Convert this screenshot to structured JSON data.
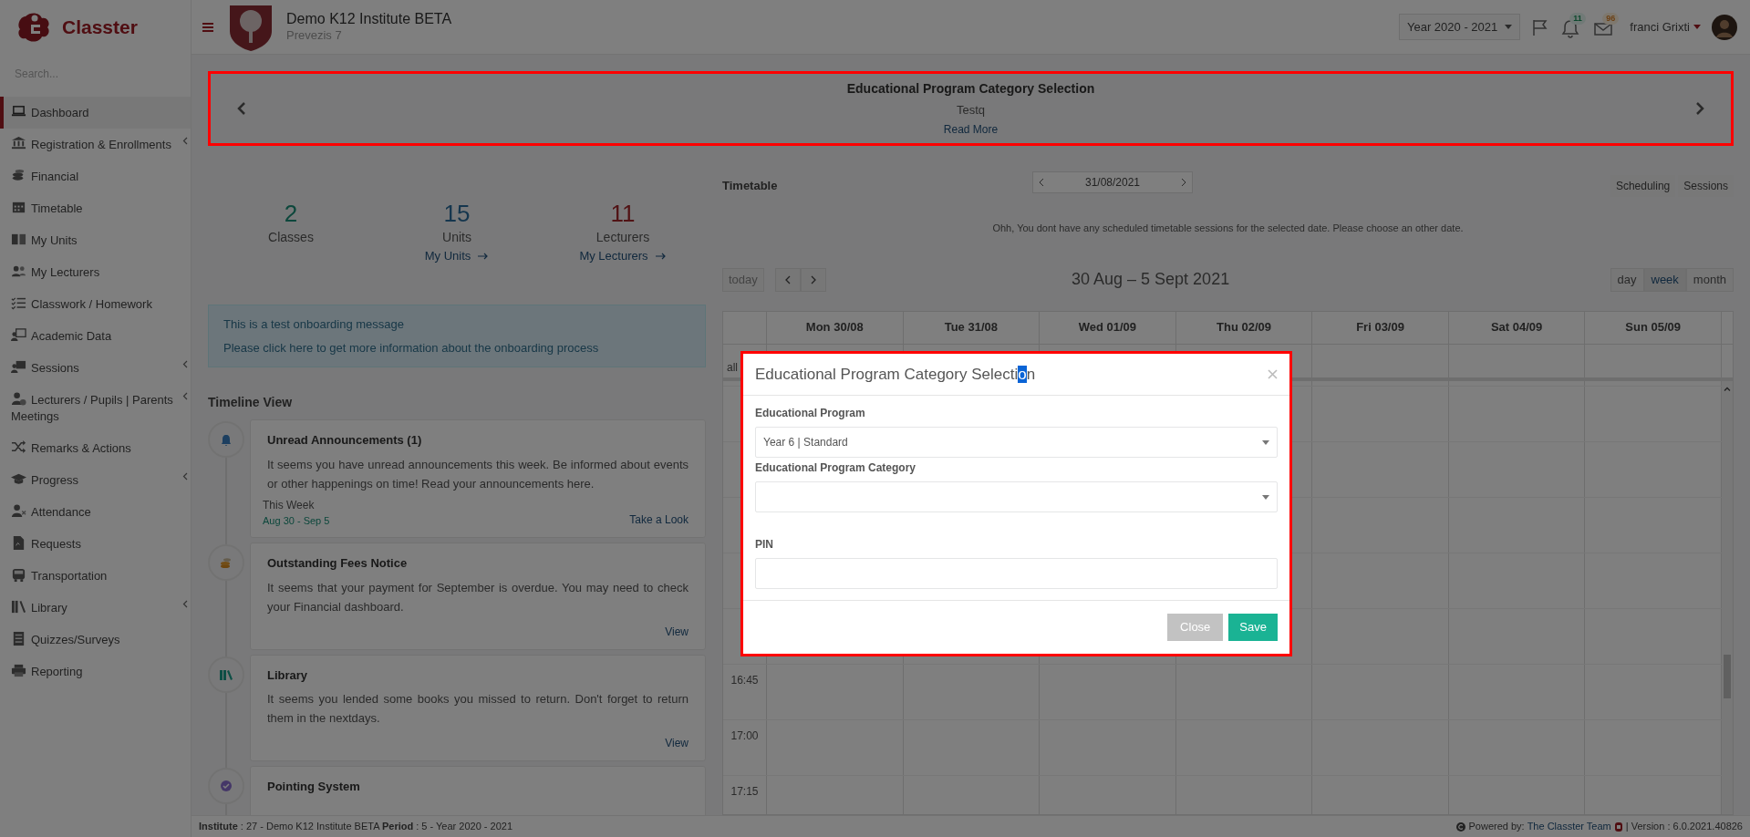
{
  "brand": {
    "name": "Classter"
  },
  "sidebar": {
    "search_placeholder": "Search...",
    "items": [
      {
        "label": "Dashboard",
        "selected": true,
        "expandable": false
      },
      {
        "label": "Registration & Enrollments",
        "selected": false,
        "expandable": true
      },
      {
        "label": "Financial",
        "selected": false,
        "expandable": false
      },
      {
        "label": "Timetable",
        "selected": false,
        "expandable": false
      },
      {
        "label": "My Units",
        "selected": false,
        "expandable": false
      },
      {
        "label": "My Lecturers",
        "selected": false,
        "expandable": false
      },
      {
        "label": "Classwork / Homework",
        "selected": false,
        "expandable": false
      },
      {
        "label": "Academic Data",
        "selected": false,
        "expandable": false
      },
      {
        "label": "Sessions",
        "selected": false,
        "expandable": true
      },
      {
        "label": "Lecturers / Pupils | Parents Meetings",
        "selected": false,
        "expandable": true
      },
      {
        "label": "Remarks & Actions",
        "selected": false,
        "expandable": false
      },
      {
        "label": "Progress",
        "selected": false,
        "expandable": true
      },
      {
        "label": "Attendance",
        "selected": false,
        "expandable": false
      },
      {
        "label": "Requests",
        "selected": false,
        "expandable": false
      },
      {
        "label": "Transportation",
        "selected": false,
        "expandable": false
      },
      {
        "label": "Library",
        "selected": false,
        "expandable": true
      },
      {
        "label": "Quizzes/Surveys",
        "selected": false,
        "expandable": false
      },
      {
        "label": "Reporting",
        "selected": false,
        "expandable": false
      }
    ]
  },
  "header": {
    "institute": "Demo K12 Institute BETA",
    "address": "Prevezis 7",
    "year": "Year 2020 - 2021",
    "notifications": "11",
    "messages": "96",
    "user": "franci Grixti"
  },
  "banner": {
    "title": "Educational Program Category Selection",
    "text": "Testq",
    "link": "Read More"
  },
  "stats": [
    {
      "value": "2",
      "label": "Classes"
    },
    {
      "value": "15",
      "label": "Units",
      "link": "My Units"
    },
    {
      "value": "11",
      "label": "Lecturers",
      "link": "My Lecturers"
    }
  ],
  "onboarding": {
    "message": "This is a test onboarding message",
    "link": "Please click here to get more information about the onboarding process"
  },
  "timeline": {
    "title": "Timeline View",
    "items": [
      {
        "title": "Unread Announcements (1)",
        "text": "It seems you have unread announcements this week. Be informed about events or other happenings on time! Read your announcements here.",
        "period_label": "This Week",
        "period": "Aug 30 - Sep 5",
        "link": "Take a Look"
      },
      {
        "title": "Outstanding Fees Notice",
        "text": "It seems that your payment for September is overdue. You may need to check your Financial dashboard.",
        "link": "View"
      },
      {
        "title": "Library",
        "text": "It seems you lended some books you missed to return. Don't forget to return them in the nextdays.",
        "link": "View"
      },
      {
        "title": "Pointing System"
      }
    ]
  },
  "timetable": {
    "title": "Timetable",
    "date": "31/08/2021",
    "buttons": [
      "Scheduling",
      "Sessions"
    ],
    "message": "Ohh, You dont have any scheduled timetable sessions for the selected date. Please choose an other date.",
    "today": "today",
    "range": "30 Aug – 5 Sept 2021",
    "views": [
      {
        "label": "day",
        "selected": false
      },
      {
        "label": "week",
        "selected": true
      },
      {
        "label": "month",
        "selected": false
      }
    ],
    "days": [
      "Mon 30/08",
      "Tue 31/08",
      "Wed 01/09",
      "Thu 02/09",
      "Fri 03/09",
      "Sat 04/09",
      "Sun 05/09"
    ],
    "allday": "all",
    "times": [
      "16:45",
      "17:00",
      "17:15"
    ]
  },
  "modal": {
    "title": {
      "before": "Educational Program Category Selecti",
      "selected": "o",
      "after": "n"
    },
    "fields": [
      {
        "kind": "select",
        "label": "Educational Program",
        "value": "Year 6 | Standard"
      },
      {
        "kind": "select",
        "label": "Educational Program Category"
      },
      {
        "kind": "text",
        "label": "PIN"
      }
    ],
    "close": "Close",
    "save": "Save"
  },
  "footer": {
    "info": "**Institute** : 27 - Demo K12 Institute BETA **Period** : 5 - Year 2020 - 2021",
    "powered": "Powered by:",
    "team": "The Classter Team",
    "version": "| Version : 6.0.2021.40826"
  }
}
